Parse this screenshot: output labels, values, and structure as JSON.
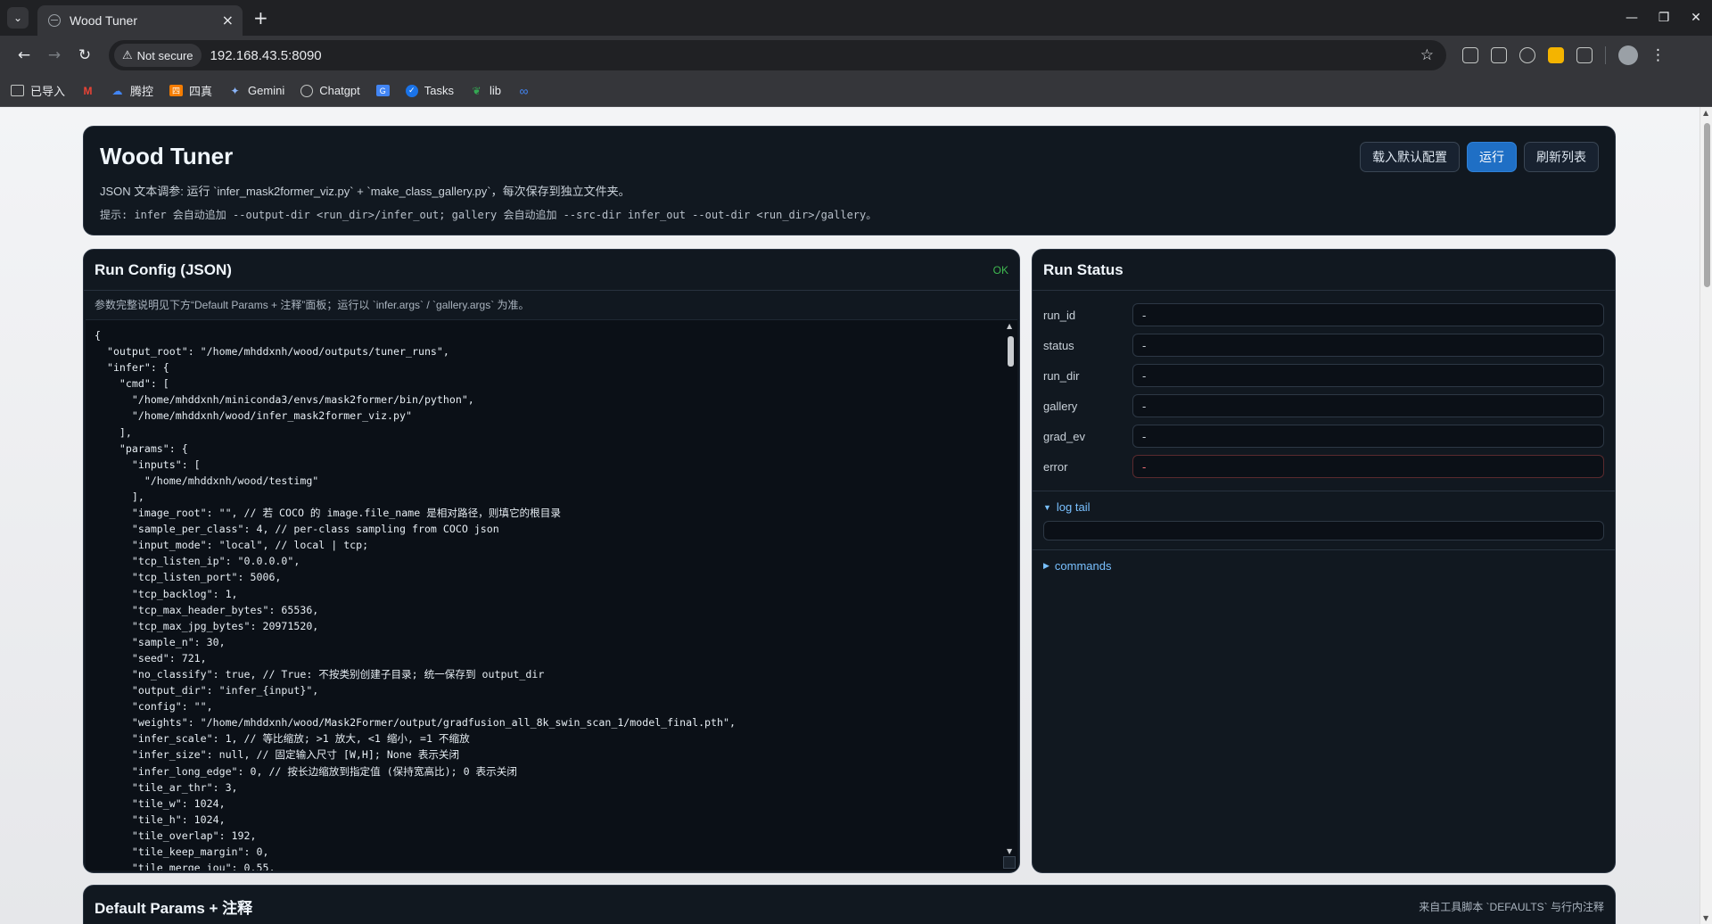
{
  "browser": {
    "tab_title": "Wood Tuner",
    "secure_label": "Not secure",
    "url": "192.168.43.5:8090",
    "bookmarks": [
      {
        "label": "已导入",
        "icon": "folder-icon"
      },
      {
        "label": "",
        "icon": "gmail-icon"
      },
      {
        "label": "腾控",
        "icon": "cloud-icon"
      },
      {
        "label": "四真",
        "icon": "orange-square-icon"
      },
      {
        "label": "Gemini",
        "icon": "gemini-icon"
      },
      {
        "label": "Chatgpt",
        "icon": "chatgpt-icon"
      },
      {
        "label": "",
        "icon": "translate-icon"
      },
      {
        "label": "Tasks",
        "icon": "tasks-icon"
      },
      {
        "label": "lib",
        "icon": "lib-icon"
      },
      {
        "label": "",
        "icon": "link-icon"
      }
    ]
  },
  "header": {
    "title": "Wood Tuner",
    "subtitle": "JSON 文本调参: 运行 `infer_mask2former_viz.py` + `make_class_gallery.py`，每次保存到独立文件夹。",
    "hint": "提示: infer 会自动追加 --output-dir <run_dir>/infer_out; gallery 会自动追加 --src-dir infer_out --out-dir <run_dir>/gallery。",
    "buttons": {
      "load_defaults": "载入默认配置",
      "run": "运行",
      "refresh": "刷新列表"
    }
  },
  "config": {
    "title": "Run Config (JSON)",
    "status": "OK",
    "note": "参数完整说明见下方“Default Params + 注释”面板；运行以 `infer.args` / `gallery.args` 为准。",
    "code_lines": [
      "{",
      "  \"output_root\": \"/home/mhddxnh/wood/outputs/tuner_runs\",",
      "  \"infer\": {",
      "    \"cmd\": [",
      "      \"/home/mhddxnh/miniconda3/envs/mask2former/bin/python\",",
      "      \"/home/mhddxnh/wood/infer_mask2former_viz.py\"",
      "    ],",
      "    \"params\": {",
      "      \"inputs\": [",
      "        \"/home/mhddxnh/wood/testimg\"",
      "      ],",
      "      \"image_root\": \"\", // 若 COCO 的 image.file_name 是相对路径，则填它的根目录",
      "      \"sample_per_class\": 4, // per-class sampling from COCO json",
      "      \"input_mode\": \"local\", // local | tcp;",
      "      \"tcp_listen_ip\": \"0.0.0.0\",",
      "      \"tcp_listen_port\": 5006,",
      "      \"tcp_backlog\": 1,",
      "      \"tcp_max_header_bytes\": 65536,",
      "      \"tcp_max_jpg_bytes\": 20971520,",
      "      \"sample_n\": 30,",
      "      \"seed\": 721,",
      "      \"no_classify\": true, // True: 不按类别创建子目录; 统一保存到 output_dir",
      "      \"output_dir\": \"infer_{input}\",",
      "      \"config\": \"\",",
      "      \"weights\": \"/home/mhddxnh/wood/Mask2Former/output/gradfusion_all_8k_swin_scan_1/model_final.pth\",",
      "      \"infer_scale\": 1, // 等比缩放; >1 放大, <1 缩小, =1 不缩放",
      "      \"infer_size\": null, // 固定输入尺寸 [W,H]; None 表示关闭",
      "      \"infer_long_edge\": 0, // 按长边缩放到指定值 (保持宽高比); 0 表示关闭",
      "      \"tile_ar_thr\": 3,",
      "      \"tile_w\": 1024,",
      "      \"tile_h\": 1024,",
      "      \"tile_overlap\": 192,",
      "      \"tile_keep_margin\": 0,",
      "      \"tile_merge_iou\": 0.55,"
    ]
  },
  "status": {
    "title": "Run Status",
    "rows": [
      {
        "label": "run_id",
        "value": "-"
      },
      {
        "label": "status",
        "value": "-"
      },
      {
        "label": "run_dir",
        "value": "-"
      },
      {
        "label": "gallery",
        "value": "-"
      },
      {
        "label": "grad_ev",
        "value": "-"
      },
      {
        "label": "error",
        "value": "-"
      }
    ],
    "log_tail_label": "log tail",
    "log_tail_value": "",
    "commands_label": "commands"
  },
  "params": {
    "title": "Default Params + 注释",
    "note": "来自工具脚本 `DEFAULTS` 与行内注释"
  }
}
